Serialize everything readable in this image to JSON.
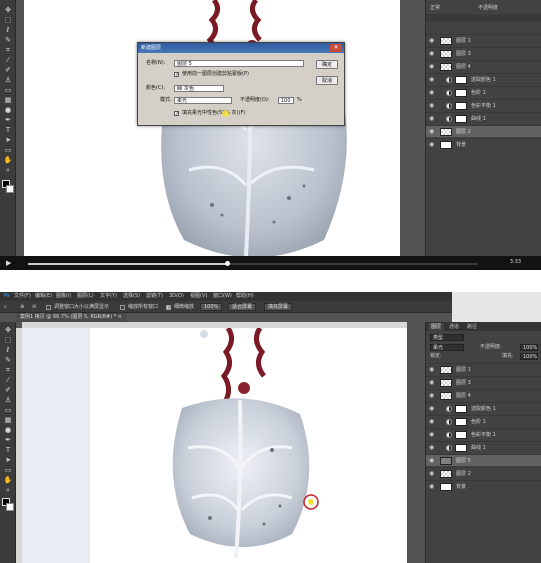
{
  "frame1": {
    "layers": [
      {
        "name": "图层 1",
        "kind": "pixel"
      },
      {
        "name": "图层 3",
        "kind": "pixel"
      },
      {
        "name": "图层 4",
        "kind": "pixel"
      },
      {
        "name": "选取颜色 1",
        "kind": "adjust"
      },
      {
        "name": "色阶 1",
        "kind": "adjust"
      },
      {
        "name": "色彩平衡 1",
        "kind": "adjust"
      },
      {
        "name": "曲线 1",
        "kind": "adjust"
      },
      {
        "name": "图层 2",
        "kind": "pixel",
        "selected": true
      },
      {
        "name": "背景",
        "kind": "bg"
      }
    ],
    "panel_header": {
      "mode": "正常",
      "opacity_label": "不透明度"
    },
    "dialog": {
      "title": "新建图层",
      "close_icon": "✕",
      "name_label": "名称(N):",
      "name_value": "图层 5",
      "clip_label": "使用前一图层创建剪贴蒙版(P)",
      "color_label": "颜色(C):",
      "color_value": "灰色",
      "mode_label": "模式:",
      "mode_value": "柔光",
      "opacity_label": "不透明度(O):",
      "opacity_value": "100",
      "opacity_unit": "%",
      "fill_label": "填充柔光中性色(50% 灰)(F)",
      "ok_label": "确定",
      "cancel_label": "取消"
    },
    "time": "3:33",
    "progress": 0.44
  },
  "frame2": {
    "menu": [
      "文件(F)",
      "编辑(E)",
      "图像(I)",
      "图层(L)",
      "文字(Y)",
      "选择(S)",
      "滤镜(T)",
      "3D(D)",
      "视图(V)",
      "窗口(W)",
      "帮助(H)"
    ],
    "options": {
      "resize_label": "调整窗口大小以满屏显示",
      "all_windows_label": "缩放所有窗口",
      "scrubby_label": "细微缩放",
      "zoom_value": "100%",
      "fit_label": "适合屏幕",
      "fill_label": "填充屏幕"
    },
    "doc_tab": "案例1 拷贝 @ 66.7% (图层 5, RGB/8#) *",
    "panel_tabs": [
      "图层",
      "通道",
      "路径"
    ],
    "kind_label": "类型",
    "mode_value": "柔光",
    "opacity_label": "不透明度:",
    "opacity_value": "100%",
    "lock_label": "锁定:",
    "fill_label": "填充:",
    "fill_value": "100%",
    "layers": [
      {
        "name": "图层 1",
        "kind": "pixel"
      },
      {
        "name": "图层 3",
        "kind": "pixel"
      },
      {
        "name": "图层 4",
        "kind": "pixel"
      },
      {
        "name": "选取颜色 1",
        "kind": "adjust"
      },
      {
        "name": "色阶 1",
        "kind": "adjust"
      },
      {
        "name": "色彩平衡 1",
        "kind": "adjust"
      },
      {
        "name": "曲线 1",
        "kind": "adjust"
      },
      {
        "name": "图层 5",
        "kind": "gray",
        "selected": true
      },
      {
        "name": "图层 2",
        "kind": "pixel"
      },
      {
        "name": "背景",
        "kind": "bg"
      }
    ]
  },
  "colors": {
    "ps_bg": "#535353",
    "panel": "#424242",
    "cord": "#7a1a24",
    "highlight": "#c8242c"
  },
  "icons": [
    "move-icon",
    "marquee-icon",
    "lasso-icon",
    "quick-select-icon",
    "crop-icon",
    "eyedropper-icon",
    "healing-icon",
    "brush-icon",
    "stamp-icon",
    "history-brush-icon",
    "eraser-icon",
    "gradient-icon",
    "blur-icon",
    "dodge-icon",
    "pen-icon",
    "type-icon",
    "path-select-icon",
    "shape-icon",
    "hand-icon",
    "zoom-icon"
  ]
}
